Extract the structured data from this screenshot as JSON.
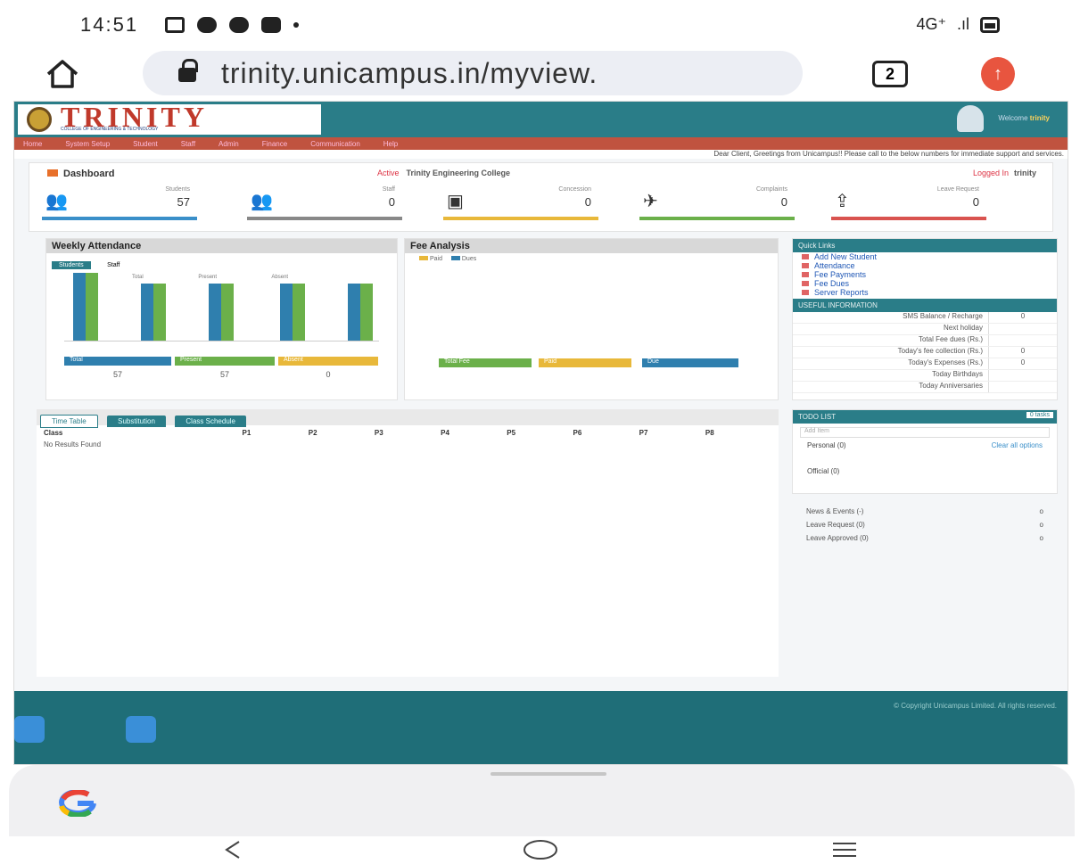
{
  "status_bar": {
    "time": "14:51",
    "network": "4G⁺",
    "signal": ".ıl"
  },
  "browser": {
    "url": "trinity.unicampus.in/myview.",
    "tab_count": "2"
  },
  "site": {
    "logo_text": "TRINITY",
    "logo_subtitle": "COLLEGE OF ENGINEERING & TECHNOLOGY",
    "welcome": "Welcome",
    "user_name": "trinity",
    "nav_items": [
      "Home",
      "System Setup",
      "Student",
      "Staff",
      "Admin",
      "Finance",
      "Communication",
      "Help"
    ],
    "marquee": "Dear Client, Greetings from Unicampus!! Please call to the below numbers for immediate support and services."
  },
  "dashboard": {
    "title": "Dashboard",
    "college_label": "Active",
    "college_name": "Trinity Engineering College",
    "logged_label": "Logged In",
    "logged_user": "trinity",
    "stats": [
      {
        "label": "Students",
        "value": "57",
        "color": "#3a8fc9",
        "icon": "students-icon"
      },
      {
        "label": "Staff",
        "value": "0",
        "color": "#888888",
        "icon": "staff-icon"
      },
      {
        "label": "Concession",
        "value": "0",
        "color": "#e8b83a",
        "icon": "concession-icon"
      },
      {
        "label": "Complaints",
        "value": "0",
        "color": "#6bb04a",
        "icon": "complaints-icon"
      },
      {
        "label": "Leave Request",
        "value": "0",
        "color": "#d9534f",
        "icon": "leave-icon"
      }
    ]
  },
  "weekly_attendance": {
    "title": "Weekly Attendance",
    "tabs": [
      "Students",
      "Staff"
    ],
    "legend": [
      "Total",
      "Present",
      "Absent"
    ],
    "counts": [
      {
        "label": "Total",
        "value": "57"
      },
      {
        "label": "Present",
        "value": "57"
      },
      {
        "label": "Absent",
        "value": "0"
      }
    ]
  },
  "fee_analysis": {
    "title": "Fee Analysis",
    "legend": [
      "Paid",
      "Dues"
    ],
    "buttons": [
      "Total Fee",
      "Paid",
      "Due"
    ]
  },
  "quick_links": {
    "title": "Quick Links",
    "items": [
      "Add New Student",
      "Attendance",
      "Fee Payments",
      "Fee Dues",
      "Server Reports"
    ]
  },
  "useful_info": {
    "title": "USEFUL INFORMATION",
    "rows": [
      {
        "k": "SMS Balance / Recharge",
        "v": "0"
      },
      {
        "k": "Next holiday",
        "v": ""
      },
      {
        "k": "Total Fee dues (Rs.)",
        "v": ""
      },
      {
        "k": "Today's fee collection (Rs.)",
        "v": "0"
      },
      {
        "k": "Today's Expenses (Rs.)",
        "v": "0"
      },
      {
        "k": "Today Birthdays",
        "v": ""
      },
      {
        "k": "Today Anniversaries",
        "v": ""
      }
    ]
  },
  "timetable": {
    "tabs": [
      "Time Table",
      "Substitution",
      "Class Schedule"
    ],
    "headers": [
      "Class",
      "P1",
      "P2",
      "P3",
      "P4",
      "P5",
      "P6",
      "P7",
      "P8"
    ],
    "empty": "No Results Found"
  },
  "todo": {
    "title": "TODO LIST",
    "badge": "0 tasks",
    "add_placeholder": "Add Item",
    "personal": "Personal (0)",
    "clear": "Clear all options",
    "official": "Official (0)"
  },
  "side_list": [
    {
      "label": "News & Events (-)",
      "v": "o"
    },
    {
      "label": "Leave Request (0)",
      "v": "o"
    },
    {
      "label": "Leave Approved (0)",
      "v": "o"
    }
  ],
  "footer": {
    "text": "© Copyright Unicampus Limited. All rights reserved."
  }
}
